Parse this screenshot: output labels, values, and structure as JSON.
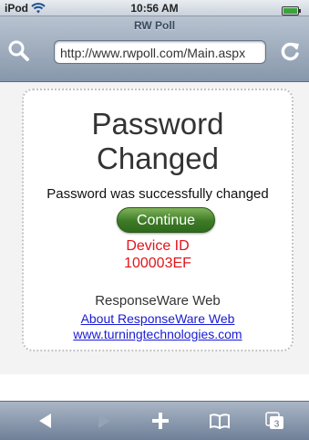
{
  "status_bar": {
    "carrier": "iPod",
    "time": "10:56 AM",
    "icons": [
      "wifi-icon",
      "battery-icon"
    ]
  },
  "browser": {
    "page_title": "RW Poll",
    "url": "http://www.rwpoll.com/Main.aspx",
    "icons": [
      "search-icon",
      "reload-icon"
    ]
  },
  "page": {
    "heading_line1": "Password",
    "heading_line2": "Changed",
    "message": "Password was successfully changed",
    "continue_label": "Continue",
    "device_id_label": "Device ID",
    "device_id_value": "100003EF",
    "app_name": "ResponseWare Web",
    "about_link": "About ResponseWare Web",
    "site_link": "www.turningtechnologies.com"
  },
  "toolbar": {
    "icons": [
      "back-icon",
      "forward-icon",
      "add-icon",
      "bookmarks-icon",
      "pages-icon"
    ],
    "pages_count": "3"
  },
  "colors": {
    "accent_red": "#e0151b",
    "link_blue": "#1a1ad4",
    "button_green": "#3d7a26",
    "chrome_blue": "#8797ab"
  }
}
